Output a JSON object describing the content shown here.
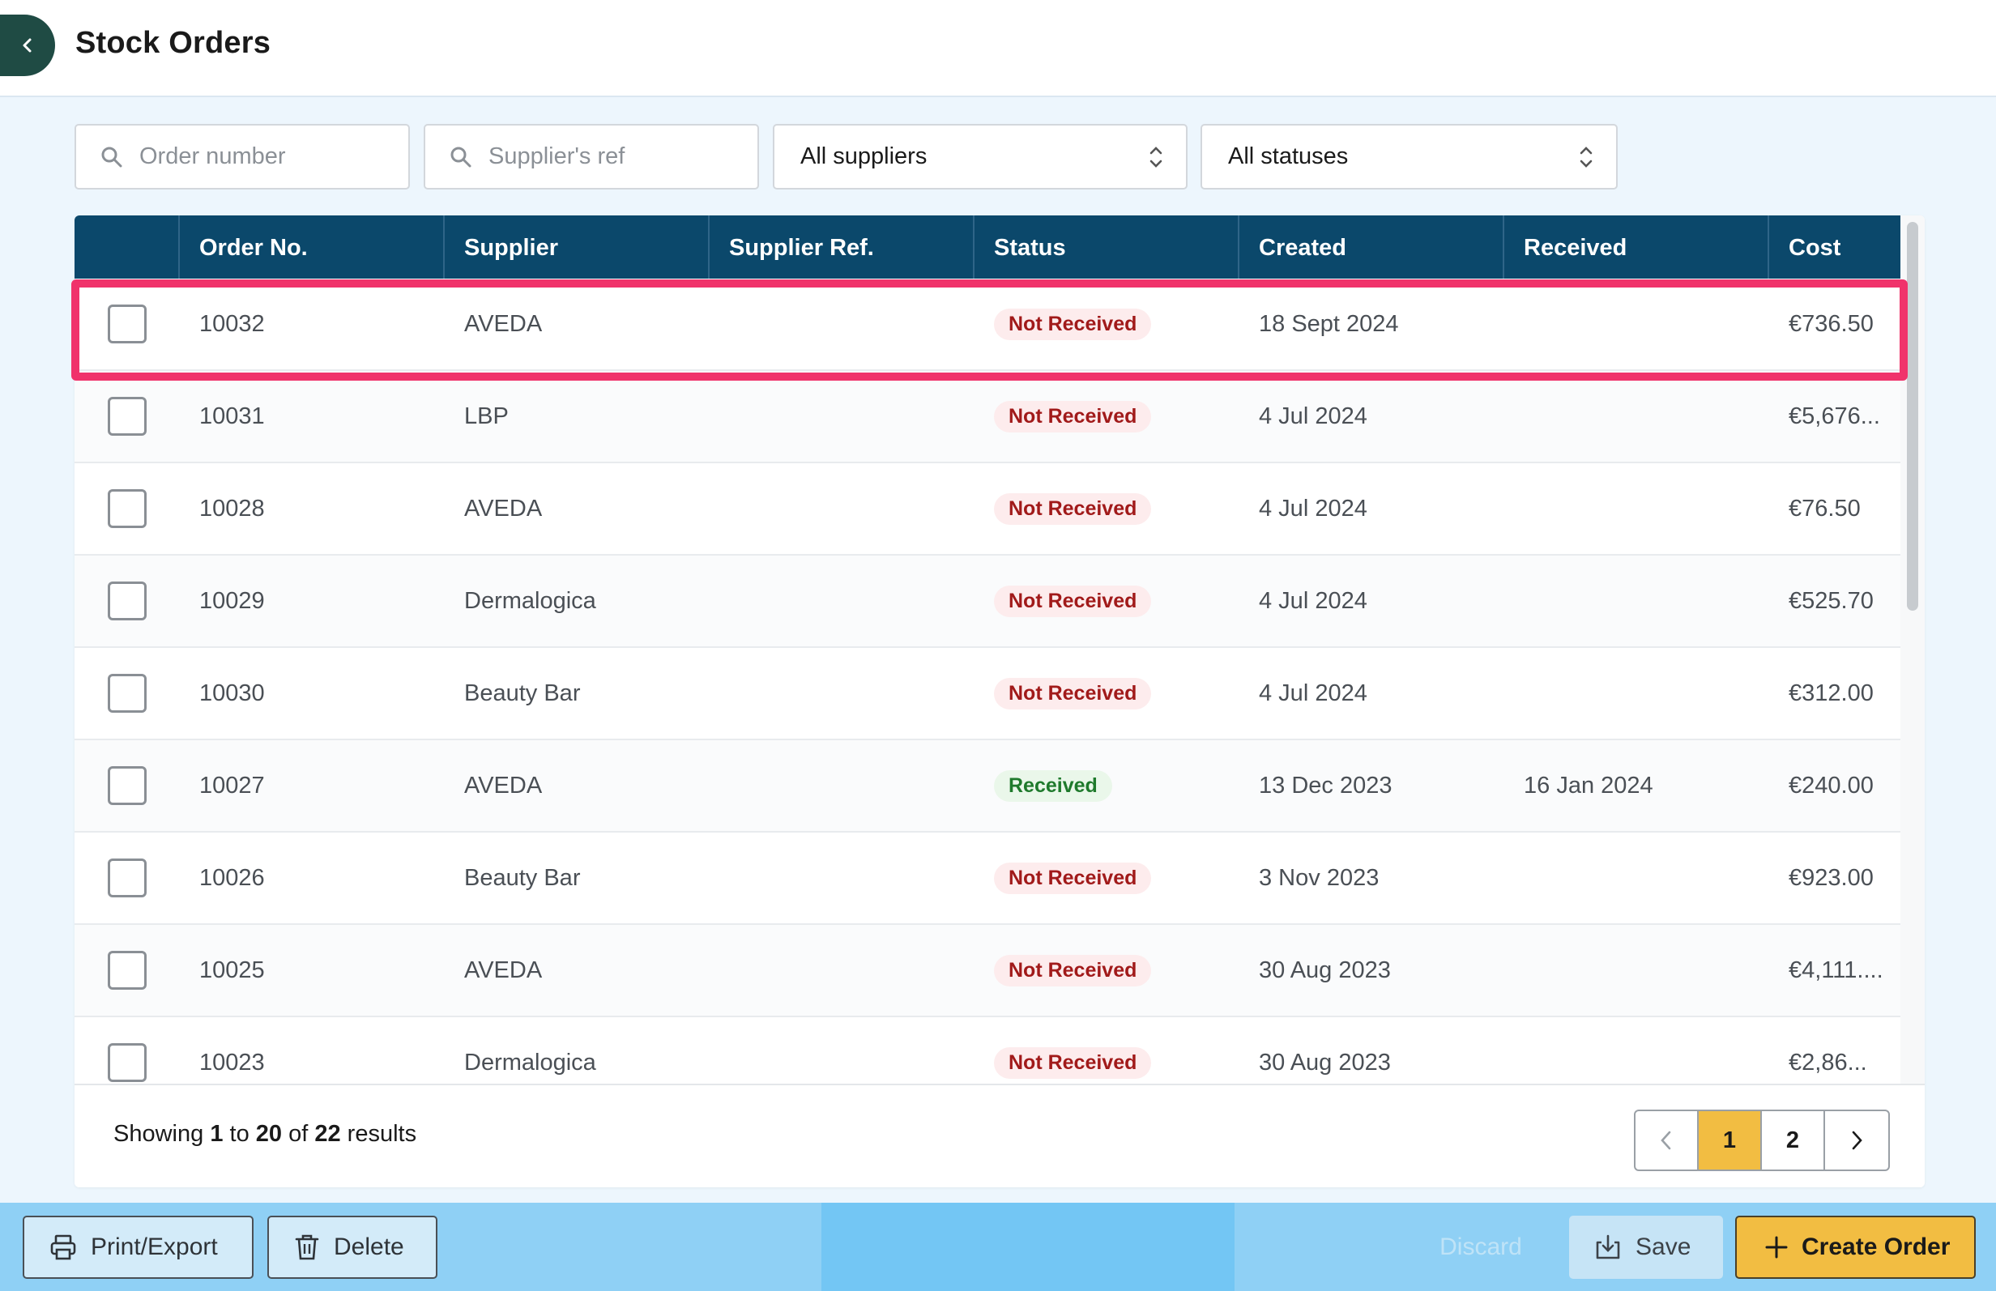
{
  "header": {
    "title": "Stock Orders"
  },
  "filters": {
    "order_number_placeholder": "Order number",
    "supplier_ref_placeholder": "Supplier's ref",
    "supplier_select": "All suppliers",
    "status_select": "All statuses"
  },
  "table": {
    "columns": [
      "",
      "Order No.",
      "Supplier",
      "Supplier Ref.",
      "Status",
      "Created",
      "Received",
      "Cost"
    ],
    "rows": [
      {
        "order": "10032",
        "supplier": "AVEDA",
        "ref": "",
        "status": "Not Received",
        "created": "18 Sept 2024",
        "received": "",
        "cost": "€736.50"
      },
      {
        "order": "10031",
        "supplier": "LBP",
        "ref": "",
        "status": "Not Received",
        "created": "4 Jul 2024",
        "received": "",
        "cost": "€5,676..."
      },
      {
        "order": "10028",
        "supplier": "AVEDA",
        "ref": "",
        "status": "Not Received",
        "created": "4 Jul 2024",
        "received": "",
        "cost": "€76.50"
      },
      {
        "order": "10029",
        "supplier": "Dermalogica",
        "ref": "",
        "status": "Not Received",
        "created": "4 Jul 2024",
        "received": "",
        "cost": "€525.70"
      },
      {
        "order": "10030",
        "supplier": "Beauty Bar",
        "ref": "",
        "status": "Not Received",
        "created": "4 Jul 2024",
        "received": "",
        "cost": "€312.00"
      },
      {
        "order": "10027",
        "supplier": "AVEDA",
        "ref": "",
        "status": "Received",
        "created": "13 Dec 2023",
        "received": "16 Jan 2024",
        "cost": "€240.00"
      },
      {
        "order": "10026",
        "supplier": "Beauty Bar",
        "ref": "",
        "status": "Not Received",
        "created": "3 Nov 2023",
        "received": "",
        "cost": "€923.00"
      },
      {
        "order": "10025",
        "supplier": "AVEDA",
        "ref": "",
        "status": "Not Received",
        "created": "30 Aug 2023",
        "received": "",
        "cost": "€4,111...."
      },
      {
        "order": "10023",
        "supplier": "Dermalogica",
        "ref": "",
        "status": "Not Received",
        "created": "30 Aug 2023",
        "received": "",
        "cost": "€2,86..."
      }
    ]
  },
  "footer": {
    "showing_prefix": "Showing",
    "from": "1",
    "to_word": "to",
    "to": "20",
    "of_word": "of",
    "total": "22",
    "results_word": "results",
    "pages": [
      "1",
      "2"
    ]
  },
  "actions": {
    "print_export": "Print/Export",
    "delete": "Delete",
    "discard": "Discard",
    "save": "Save",
    "create_order": "Create Order"
  },
  "colors": {
    "header_bg": "#0b486b",
    "accent": "#f2bd42",
    "highlight": "#f0336b",
    "action_bar": "#8fd0f5"
  }
}
